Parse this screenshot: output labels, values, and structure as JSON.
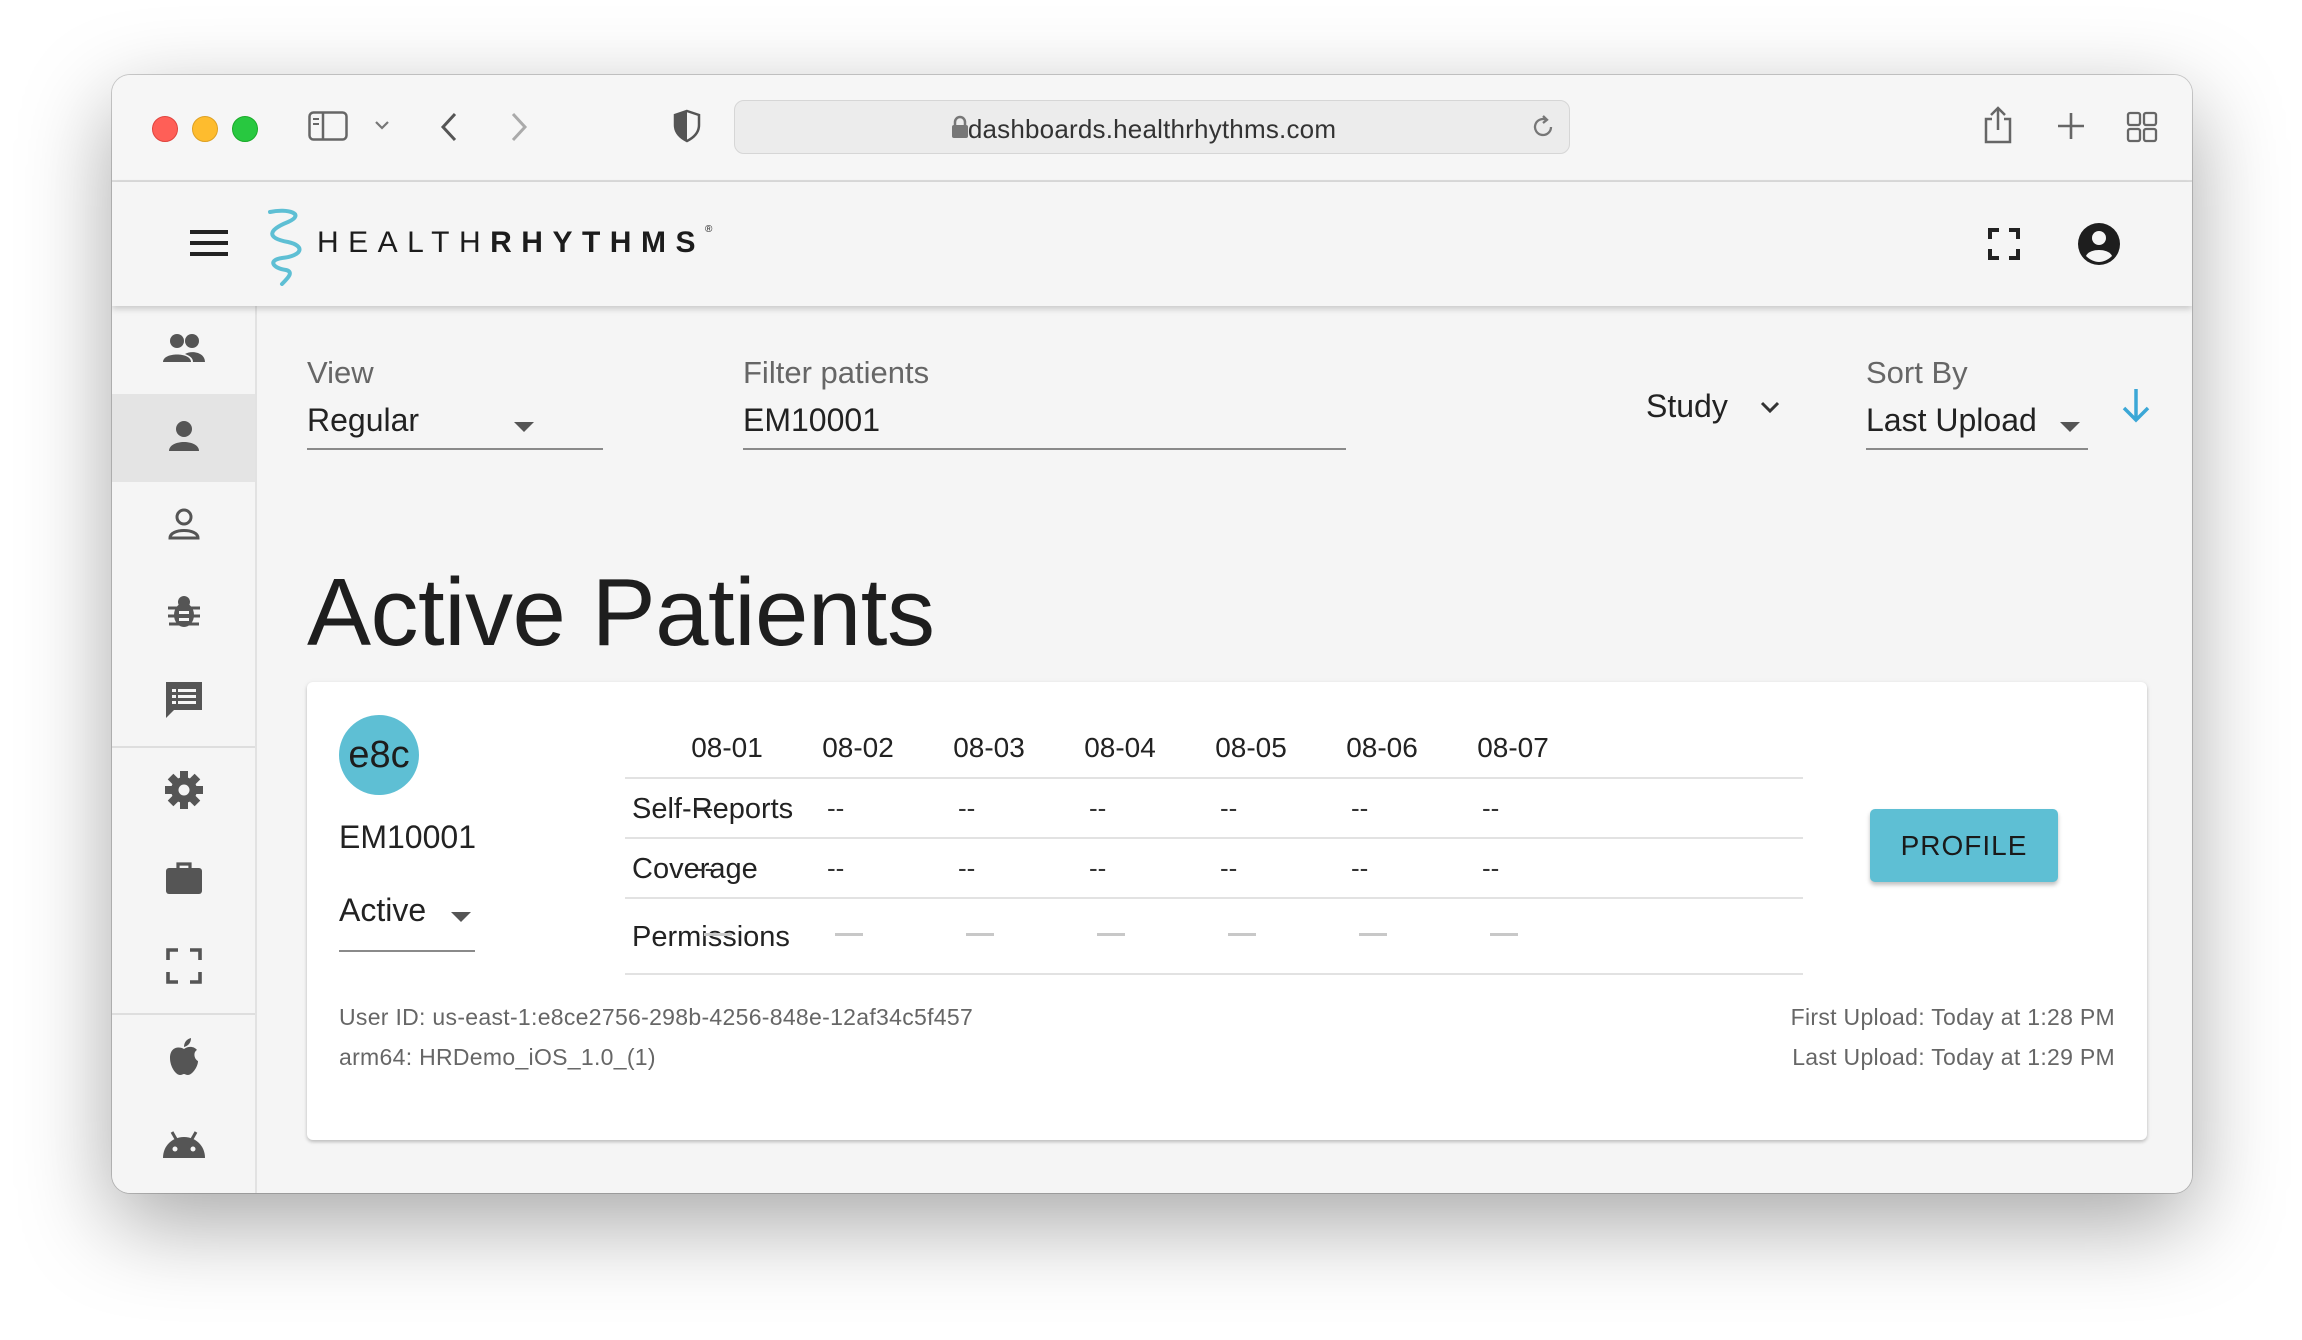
{
  "browser": {
    "url": "dashboards.healthrhythms.com"
  },
  "app": {
    "logo_light": "HEALTH",
    "logo_bold": "RHYTHMS",
    "logo_mark": "®"
  },
  "sidebar": {
    "items": [
      {
        "icon": "people-icon"
      },
      {
        "icon": "person-icon",
        "active": true
      },
      {
        "icon": "person-outline-icon"
      },
      {
        "icon": "bug-icon"
      },
      {
        "icon": "feedback-list-icon"
      },
      {
        "icon": "gear-icon"
      },
      {
        "icon": "briefcase-icon"
      },
      {
        "icon": "fullscreen-icon"
      },
      {
        "icon": "apple-icon"
      },
      {
        "icon": "android-icon"
      }
    ]
  },
  "filters": {
    "view_label": "View",
    "view_value": "Regular",
    "filter_label": "Filter patients",
    "filter_value": "EM10001",
    "study_label": "Study",
    "sort_label": "Sort By",
    "sort_value": "Last Upload"
  },
  "page_title": "Active Patients",
  "patient": {
    "avatar_text": "e8c",
    "id": "EM10001",
    "status": "Active",
    "dates": [
      "08-01",
      "08-02",
      "08-03",
      "08-04",
      "08-05",
      "08-06",
      "08-07"
    ],
    "rows": [
      {
        "label": "Self-Reports",
        "values": [
          "--",
          "--",
          "--",
          "--",
          "--",
          "--",
          "--"
        ]
      },
      {
        "label": "Coverage",
        "values": [
          "--",
          "--",
          "--",
          "--",
          "--",
          "--",
          "--"
        ]
      },
      {
        "label": "Permissions"
      }
    ],
    "profile_button": "PROFILE",
    "user_id": "User ID: us-east-1:e8ce2756-298b-4256-848e-12af34c5f457",
    "device": "arm64: HRDemo_iOS_1.0_(1)",
    "first_upload": "First Upload: Today at 1:28 PM",
    "last_upload": "Last Upload: Today at 1:29 PM"
  },
  "colors": {
    "accent": "#5ebfd4",
    "sort_arrow": "#3ba7d6"
  }
}
